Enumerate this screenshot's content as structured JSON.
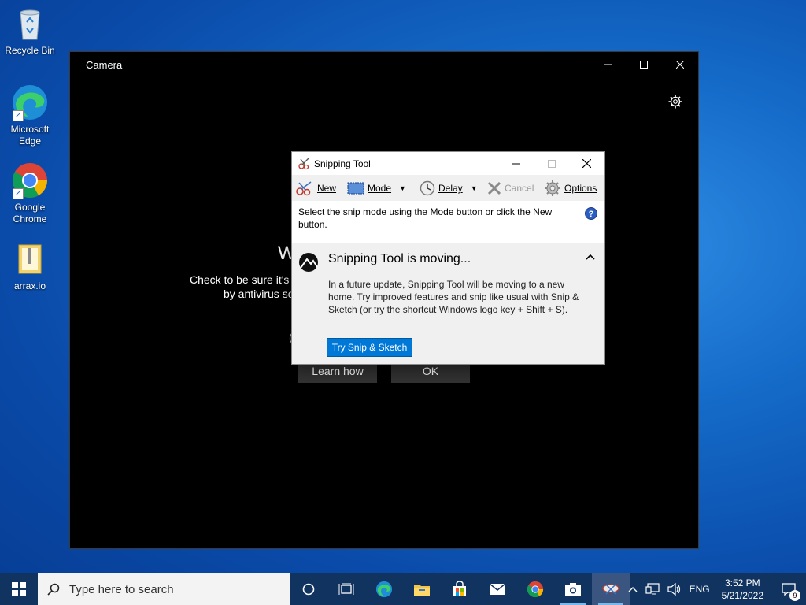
{
  "desktop": {
    "icons": [
      {
        "label": "Recycle Bin"
      },
      {
        "label": "Microsoft Edge"
      },
      {
        "label": "Google Chrome"
      },
      {
        "label": "arrax.io"
      }
    ]
  },
  "camera": {
    "title": "Camera",
    "message_title_partial": "W",
    "message_line1_partial": "Check to be sure it's c",
    "message_line2_partial": "by antivirus so",
    "paren_partial": "(",
    "learn_how": "Learn how",
    "ok": "OK"
  },
  "snipping_tool": {
    "title": "Snipping Tool",
    "toolbar": {
      "new": "New",
      "mode": "Mode",
      "delay": "Delay",
      "cancel": "Cancel",
      "options": "Options"
    },
    "instruction": "Select the snip mode using the Mode button or click the New button.",
    "help": "?",
    "banner": {
      "heading": "Snipping Tool is moving...",
      "text": "In a future update, Snipping Tool will be moving to a new home. Try improved features and snip like usual with Snip & Sketch (or try the shortcut Windows logo key + Shift + S).",
      "button": "Try Snip & Sketch"
    }
  },
  "taskbar": {
    "search_placeholder": "Type here to search",
    "language": "ENG",
    "time": "3:52 PM",
    "date": "5/21/2022",
    "notification_count": "9"
  },
  "colors": {
    "accent": "#0078d7",
    "taskbar": "#10335f",
    "desktop": "#1469c7"
  }
}
